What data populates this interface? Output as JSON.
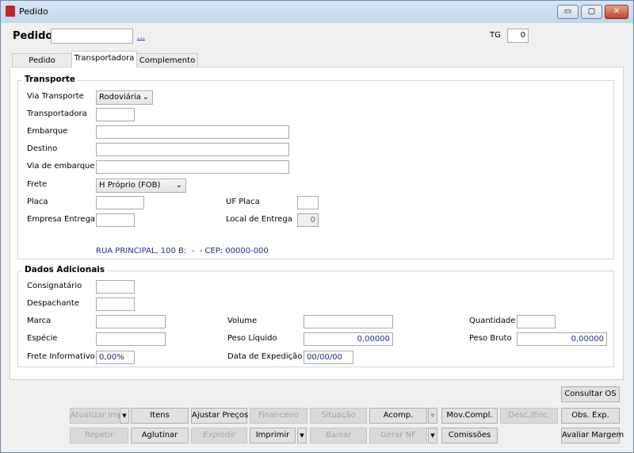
{
  "window": {
    "title": "Pedido",
    "minimize": "▭",
    "maximize": "▢",
    "close": "✕"
  },
  "header": {
    "pedido_label": "Pedido",
    "pedido_value": "",
    "lookup": "...",
    "tg_label": "TG",
    "tg_value": "0"
  },
  "tabs": [
    {
      "label": "Pedido"
    },
    {
      "label": "Transportadora",
      "active": true
    },
    {
      "label": "Complemento"
    }
  ],
  "transporte": {
    "title": "Transporte",
    "via_transporte_label": "Via Transporte",
    "via_transporte_value": "Rodoviária",
    "transportadora_label": "Transportadora",
    "transportadora_value": "",
    "embarque_label": "Embarque",
    "embarque_value": "",
    "destino_label": "Destino",
    "destino_value": "",
    "via_embarque_label": "Via de embarque",
    "via_embarque_value": "",
    "frete_label": "Frete",
    "frete_value": "H Próprio (FOB)",
    "placa_label": "Placa",
    "placa_value": "",
    "uf_placa_label": "UF Placa",
    "uf_placa_value": "",
    "empresa_entrega_label": "Empresa Entrega",
    "empresa_entrega_value": "",
    "local_entrega_label": "Local de Entrega",
    "local_entrega_value": "0",
    "address": "RUA PRINCIPAL, 100 B:  -  - CEP: 00000-000"
  },
  "dados": {
    "title": "Dados Adicionais",
    "consignatario_label": "Consignatário",
    "despachante_label": "Despachante",
    "marca_label": "Marca",
    "volume_label": "Volume",
    "quantidade_label": "Quantidade",
    "especie_label": "Espécie",
    "peso_liquido_label": "Peso Líquido",
    "peso_liquido_value": "0,00000",
    "peso_bruto_label": "Peso Bruto",
    "peso_bruto_value": "0,00000",
    "frete_info_label": "Frete Informativo",
    "frete_info_value": "0,00%",
    "data_exp_label": "Data de Expedição",
    "data_exp_value": "00/00/00"
  },
  "buttons": {
    "consultar_os": "Consultar OS",
    "atualizar_imp": "Atualizar Imp",
    "itens": "Itens",
    "ajustar_precos": "Ajustar Preços",
    "financeiro": "Financeiro",
    "situacao": "Situação",
    "acomp": "Acomp.",
    "mov_compl": "Mov.Compl.",
    "desc_enc": "Desc./Enc.",
    "obs_exp": "Obs. Exp.",
    "repetir": "Repetir",
    "aglutinar": "Aglutinar",
    "explodir": "Explodir",
    "imprimir": "Imprimir",
    "baixar": "Baixar",
    "gerar_nf": "Gerar NF",
    "comissoes": "Comissões",
    "avaliar_margem": "Avaliar Margem",
    "dropdown": "▼"
  }
}
